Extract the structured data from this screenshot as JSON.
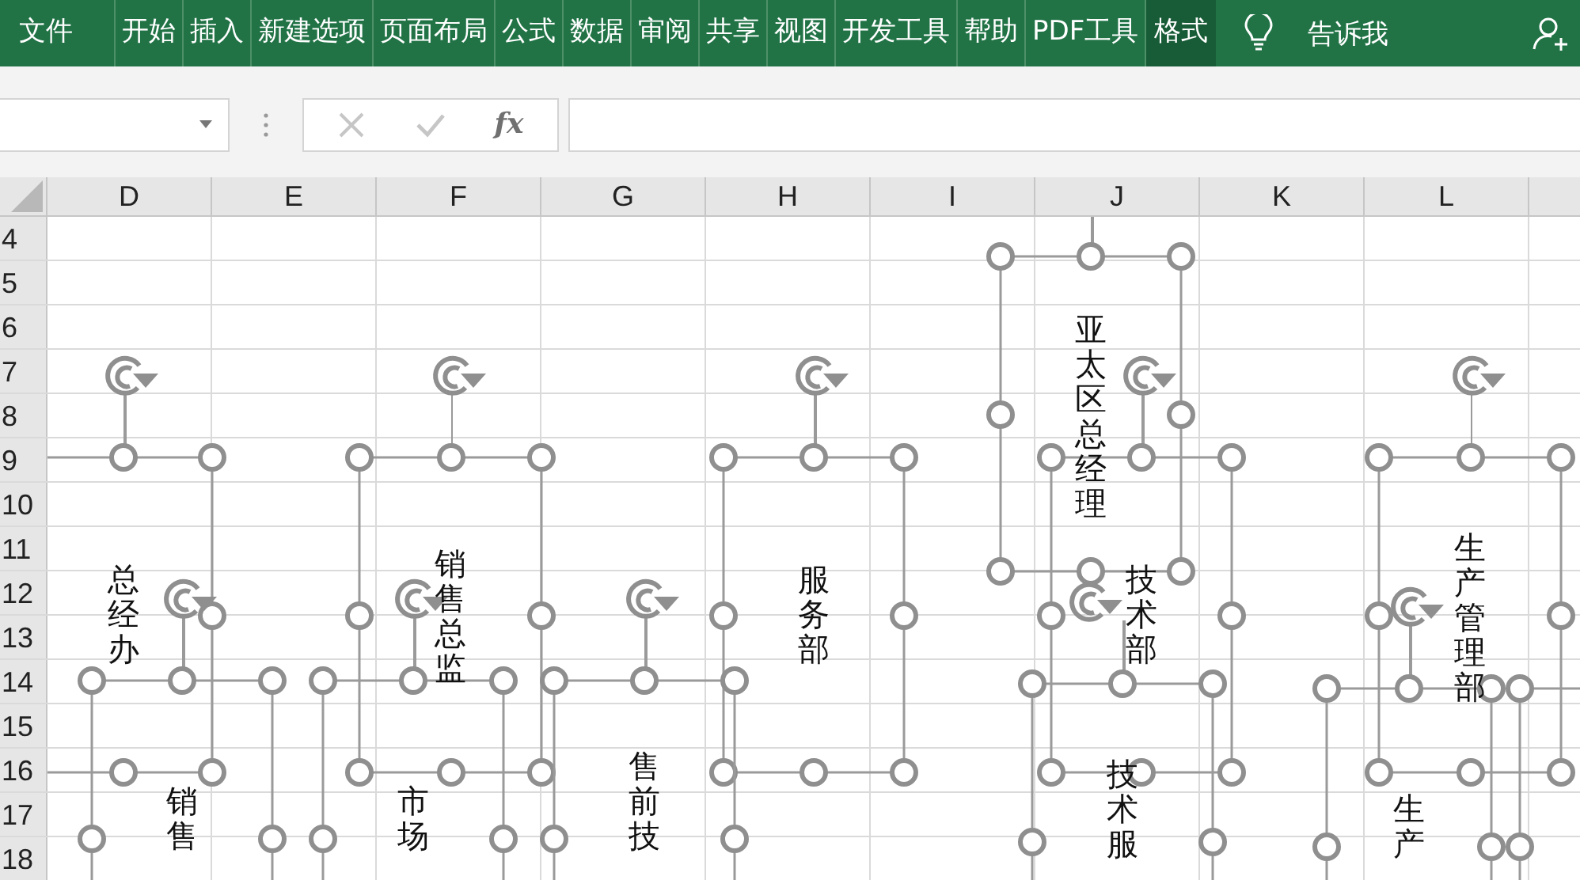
{
  "ribbon": {
    "tabs": [
      {
        "label": "文件",
        "selected": false
      },
      {
        "label": "开始",
        "selected": false
      },
      {
        "label": "插入",
        "selected": false
      },
      {
        "label": "新建选项",
        "selected": false
      },
      {
        "label": "页面布局",
        "selected": false
      },
      {
        "label": "公式",
        "selected": false
      },
      {
        "label": "数据",
        "selected": false
      },
      {
        "label": "审阅",
        "selected": false
      },
      {
        "label": "共享",
        "selected": false
      },
      {
        "label": "视图",
        "selected": false
      },
      {
        "label": "开发工具",
        "selected": false
      },
      {
        "label": "帮助",
        "selected": false
      },
      {
        "label": "PDF工具",
        "selected": false
      },
      {
        "label": "格式",
        "selected": true
      }
    ],
    "tell_me": "告诉我"
  },
  "formula_bar": {
    "function_label": "fx"
  },
  "sheet": {
    "columns": [
      "D",
      "E",
      "F",
      "G",
      "H",
      "I",
      "J",
      "K",
      "L"
    ],
    "rows": [
      "4",
      "5",
      "6",
      "7",
      "8",
      "9",
      "10",
      "11",
      "12",
      "13",
      "14",
      "15",
      "16",
      "17",
      "18"
    ],
    "shapes": [
      {
        "text": "总经办",
        "selected": true
      },
      {
        "text": "销售总监",
        "selected": true
      },
      {
        "text": "服务部",
        "selected": true
      },
      {
        "text": "亚太区总经理",
        "selected": true
      },
      {
        "text": "技术部",
        "selected": true
      },
      {
        "text": "生产管理部",
        "selected": true
      },
      {
        "text": "销售",
        "selected": true
      },
      {
        "text": "市场",
        "selected": true
      },
      {
        "text": "售前技",
        "selected": true
      },
      {
        "text": "技术服",
        "selected": true
      },
      {
        "text": "生产",
        "selected": true
      },
      {
        "selected": true
      }
    ]
  }
}
